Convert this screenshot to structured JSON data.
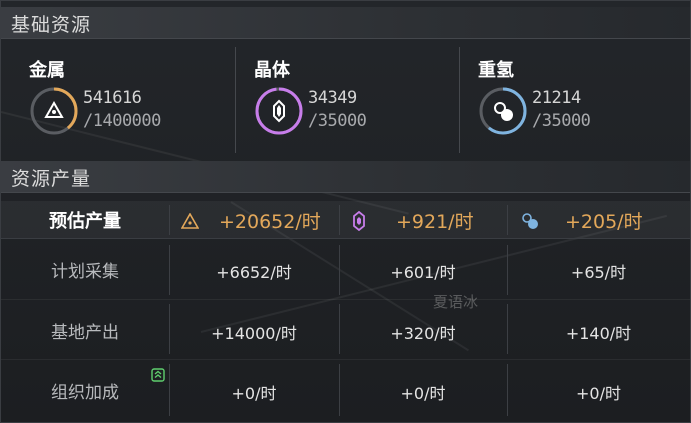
{
  "base_resources": {
    "title": "基础资源",
    "items": [
      {
        "name": "金属",
        "current": "541616",
        "max": "/1400000",
        "icon": "metal-triangle-icon",
        "color": "#e3a85a",
        "fill": 0.39
      },
      {
        "name": "晶体",
        "current": "34349",
        "max": "/35000",
        "icon": "crystal-hexagon-icon",
        "color": "#c77dea",
        "fill": 0.98
      },
      {
        "name": "重氢",
        "current": "21214",
        "max": "/35000",
        "icon": "deuterium-circle-icon",
        "color": "#7fb4e0",
        "fill": 0.61
      }
    ]
  },
  "production": {
    "title": "资源产量",
    "estimate_label": "预估产量",
    "estimate": [
      "+20652/时",
      "+921/时",
      "+205/时"
    ],
    "rows": [
      {
        "label": "计划采集",
        "values": [
          "+6652/时",
          "+601/时",
          "+65/时"
        ]
      },
      {
        "label": "基地产出",
        "values": [
          "+14000/时",
          "+320/时",
          "+140/时"
        ]
      },
      {
        "label": "组织加成",
        "values": [
          "+0/时",
          "+0/时",
          "+0/时"
        ],
        "icon": "organization-badge-icon"
      }
    ]
  },
  "watermark": "夏语冰"
}
